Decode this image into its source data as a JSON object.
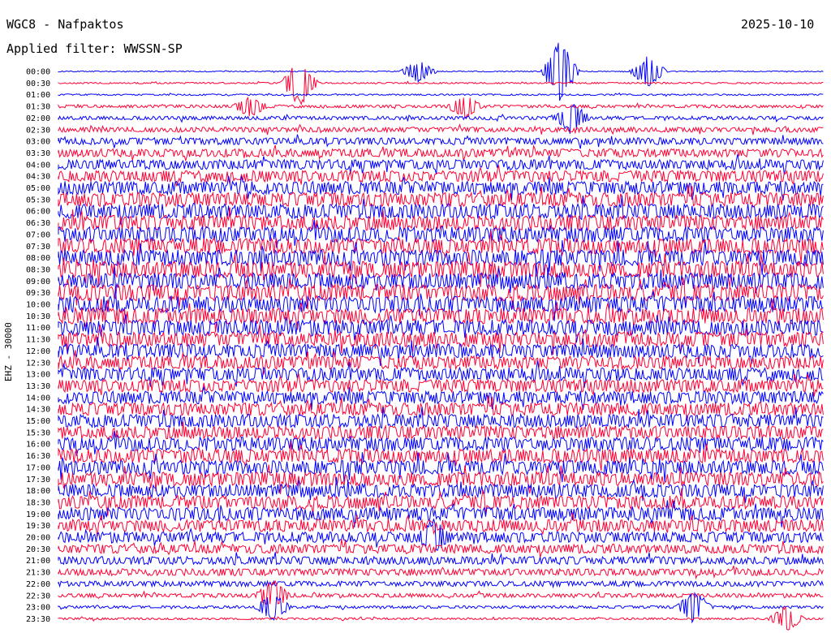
{
  "header": {
    "station": "WGC8 - Nafpaktos",
    "date": "2025-10-10",
    "filter": "Applied filter: WWSSN-SP",
    "channel": "EHZ - 30000"
  },
  "chart_data": {
    "type": "line",
    "description_units": "helicorder: one trace per 30-minute interval, amplitude vs time",
    "rows": [
      "00:00",
      "00:30",
      "01:00",
      "01:30",
      "02:00",
      "02:30",
      "03:00",
      "03:30",
      "04:00",
      "04:30",
      "05:00",
      "05:30",
      "06:00",
      "06:30",
      "07:00",
      "07:30",
      "08:00",
      "08:30",
      "09:00",
      "09:30",
      "10:00",
      "10:30",
      "11:00",
      "11:30",
      "12:00",
      "12:30",
      "13:00",
      "13:30",
      "14:00",
      "14:30",
      "15:00",
      "15:30",
      "16:00",
      "16:30",
      "17:00",
      "17:30",
      "18:00",
      "18:30",
      "19:00",
      "19:30",
      "20:00",
      "20:30",
      "21:00",
      "21:30",
      "22:00",
      "22:30",
      "23:00",
      "23:30"
    ],
    "colors": [
      "#0000ff",
      "#ff0033"
    ],
    "noise_level": [
      0.6,
      0.9,
      0.9,
      1.8,
      2.2,
      3.0,
      4.2,
      5.0,
      6.0,
      7.0,
      8.0,
      8.5,
      9.0,
      9.2,
      9.5,
      9.5,
      9.8,
      10,
      10,
      10,
      10,
      9.8,
      9.5,
      9.0,
      8.5,
      8.0,
      8.0,
      7.8,
      7.8,
      7.8,
      8.0,
      8.0,
      8.5,
      8.5,
      8.5,
      8.5,
      8.0,
      8.0,
      8.0,
      7.5,
      6.5,
      5.5,
      4.8,
      4.2,
      3.2,
      2.4,
      1.6,
      1.2
    ],
    "events": [
      {
        "row": 0,
        "x": 0.47,
        "amp": 14
      },
      {
        "row": 0,
        "x": 0.655,
        "amp": 40
      },
      {
        "row": 0,
        "x": 0.77,
        "amp": 20
      },
      {
        "row": 1,
        "x": 0.315,
        "amp": 30
      },
      {
        "row": 3,
        "x": 0.25,
        "amp": 14
      },
      {
        "row": 3,
        "x": 0.53,
        "amp": 16
      },
      {
        "row": 4,
        "x": 0.67,
        "amp": 22
      },
      {
        "row": 45,
        "x": 0.28,
        "amp": 20
      },
      {
        "row": 46,
        "x": 0.28,
        "amp": 18
      },
      {
        "row": 46,
        "x": 0.83,
        "amp": 22
      },
      {
        "row": 47,
        "x": 0.95,
        "amp": 16
      },
      {
        "row": 40,
        "x": 0.49,
        "amp": 24
      }
    ]
  }
}
